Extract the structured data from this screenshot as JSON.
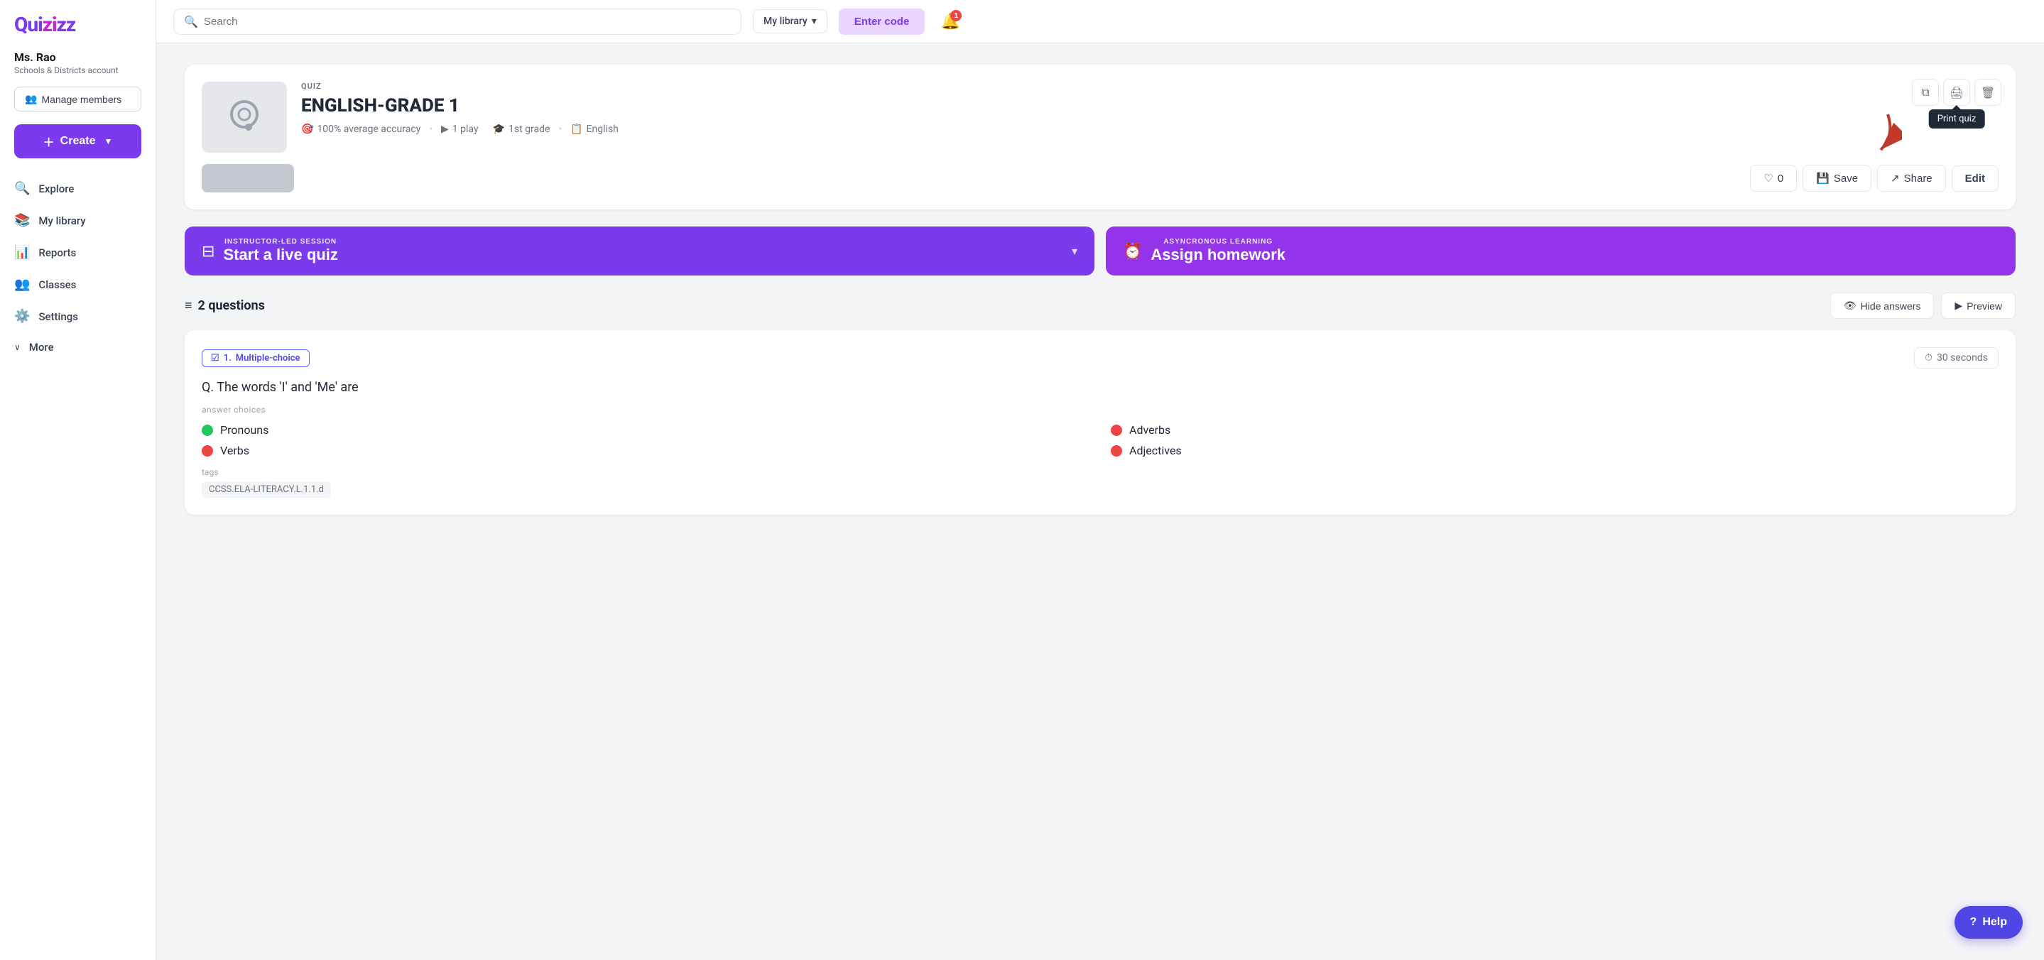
{
  "sidebar": {
    "logo": "Quizizz",
    "user": {
      "name": "Ms. Rao",
      "account_type": "Schools & Districts account"
    },
    "manage_members_label": "Manage members",
    "create_label": "Create",
    "nav_items": [
      {
        "id": "explore",
        "label": "Explore",
        "icon": "🔍"
      },
      {
        "id": "my-library",
        "label": "My library",
        "icon": "📚"
      },
      {
        "id": "reports",
        "label": "Reports",
        "icon": "📊"
      },
      {
        "id": "classes",
        "label": "Classes",
        "icon": "👥"
      },
      {
        "id": "settings",
        "label": "Settings",
        "icon": "⚙️"
      },
      {
        "id": "more",
        "label": "More",
        "icon": "∨"
      }
    ]
  },
  "header": {
    "search_placeholder": "Search",
    "library_selector": "My library",
    "enter_code_label": "Enter code",
    "notification_count": "1"
  },
  "quiz": {
    "type_label": "QUIZ",
    "title": "ENGLISH-GRADE 1",
    "accuracy": "100% average accuracy",
    "plays": "1 play",
    "grade": "1st grade",
    "language": "English",
    "action_buttons": {
      "copy_icon": "copy",
      "print_icon": "print",
      "delete_icon": "delete",
      "tooltip": "Print quiz"
    },
    "like_count": "0",
    "save_label": "Save",
    "share_label": "Share",
    "edit_label": "Edit"
  },
  "session_buttons": {
    "live": {
      "label": "INSTRUCTOR-LED SESSION",
      "title": "Start a live quiz"
    },
    "homework": {
      "label": "ASYNCRONOUS LEARNING",
      "title": "Assign homework"
    }
  },
  "questions_section": {
    "count": "2 questions",
    "hide_answers_label": "Hide answers",
    "preview_label": "Preview"
  },
  "question1": {
    "number": "1",
    "type": "Multiple-choice",
    "time": "30 seconds",
    "question_text": "Q. The words 'I' and 'Me' are",
    "answer_choices_label": "answer choices",
    "answers": [
      {
        "id": "pronouns",
        "text": "Pronouns",
        "correct": true
      },
      {
        "id": "adverbs",
        "text": "Adverbs",
        "correct": false
      },
      {
        "id": "verbs",
        "text": "Verbs",
        "correct": false
      },
      {
        "id": "adjectives",
        "text": "Adjectives",
        "correct": false
      }
    ],
    "tags_label": "tags",
    "tag": "CCSS.ELA-LITERACY.L.1.1.d"
  },
  "help": {
    "label": "Help"
  }
}
